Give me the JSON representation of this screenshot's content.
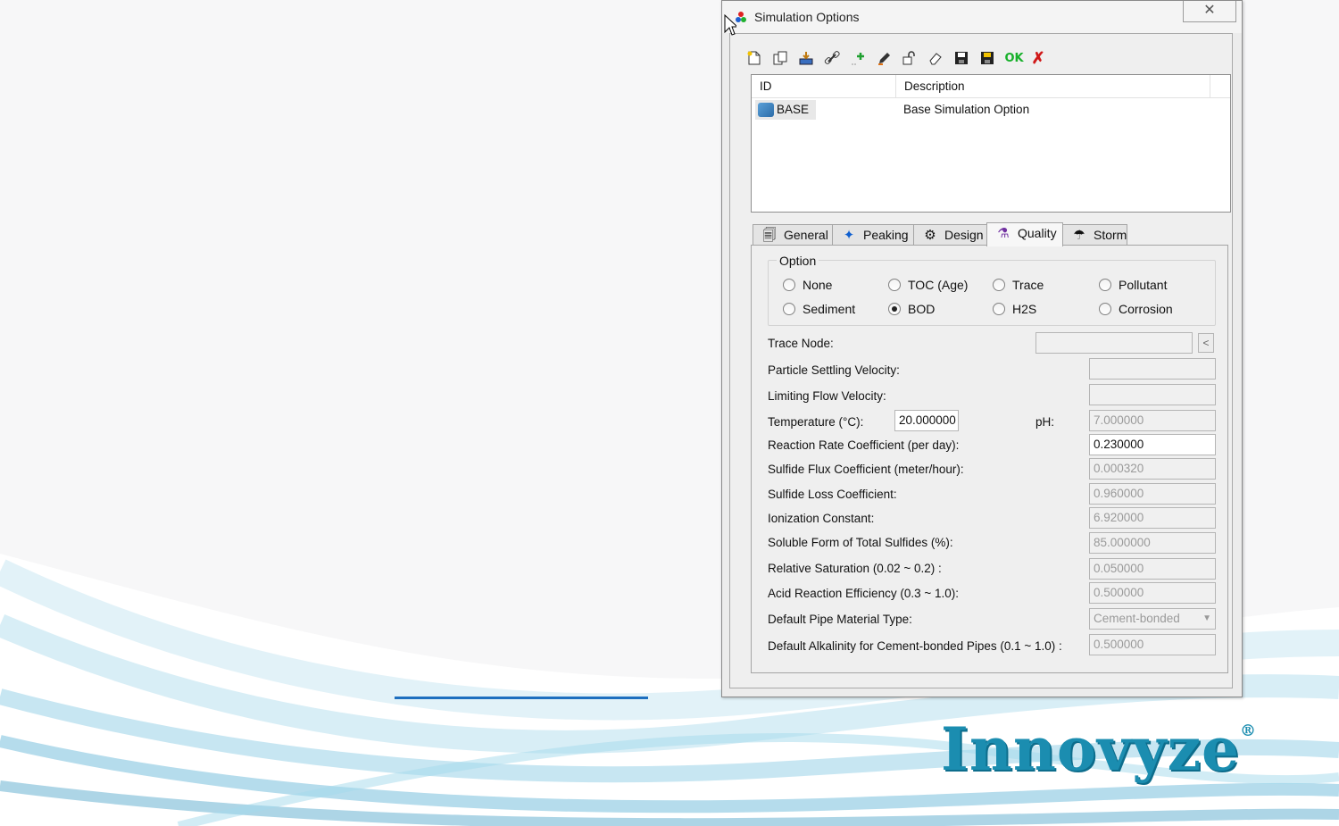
{
  "window": {
    "title": "Simulation Options",
    "close_label": "✕"
  },
  "toolbar": {
    "buttons": [
      {
        "icon": "new-icon"
      },
      {
        "icon": "copy-icon"
      },
      {
        "icon": "import-icon"
      },
      {
        "icon": "link-icon"
      },
      {
        "icon": "add-icon"
      },
      {
        "icon": "edit-icon"
      },
      {
        "icon": "unlock-icon"
      },
      {
        "icon": "eraser-icon"
      },
      {
        "icon": "save-icon"
      },
      {
        "icon": "save-all-icon"
      }
    ],
    "ok_label": "OK",
    "cancel_label": "✗"
  },
  "list": {
    "columns": [
      "ID",
      "Description"
    ],
    "rows": [
      {
        "id": "BASE",
        "description": "Base Simulation Option"
      }
    ]
  },
  "tabs": [
    {
      "label": "General",
      "icon": "general-icon"
    },
    {
      "label": "Peaking",
      "icon": "peaking-icon"
    },
    {
      "label": "Design",
      "icon": "design-icon"
    },
    {
      "label": "Quality",
      "icon": "quality-icon",
      "active": true
    },
    {
      "label": "Storm",
      "icon": "storm-icon"
    }
  ],
  "option_group": {
    "label": "Option",
    "options": [
      "None",
      "TOC (Age)",
      "Trace",
      "Pollutant",
      "Sediment",
      "BOD",
      "H2S",
      "Corrosion"
    ],
    "selected": "BOD"
  },
  "fields": {
    "trace_node": {
      "label": "Trace Node:",
      "value": ""
    },
    "particle_settling_velocity": {
      "label": "Particle Settling Velocity:",
      "value": ""
    },
    "limiting_flow_velocity": {
      "label": "Limiting Flow Velocity:",
      "value": ""
    },
    "temperature": {
      "label": "Temperature (°C):",
      "value": "20.000000"
    },
    "ph": {
      "label": "pH:",
      "value": "7.000000"
    },
    "reaction_rate_coefficient": {
      "label": "Reaction Rate Coefficient (per day):",
      "value": "0.230000"
    },
    "sulfide_flux_coefficient": {
      "label": "Sulfide Flux Coefficient (meter/hour):",
      "value": "0.000320"
    },
    "sulfide_loss_coefficient": {
      "label": "Sulfide Loss Coefficient:",
      "value": "0.960000"
    },
    "ionization_constant": {
      "label": "Ionization Constant:",
      "value": "6.920000"
    },
    "soluble_form_total_sulfides": {
      "label": "Soluble Form of Total Sulfides (%):",
      "value": "85.000000"
    },
    "relative_saturation": {
      "label": "Relative Saturation (0.02 ~ 0.2) :",
      "value": "0.050000"
    },
    "acid_reaction_efficiency": {
      "label": "Acid Reaction Efficiency (0.3 ~ 1.0):",
      "value": "0.500000"
    },
    "default_pipe_material": {
      "label": "Default Pipe Material Type:",
      "value": "Cement-bonded"
    },
    "default_alkalinity": {
      "label": "Default Alkalinity for Cement-bonded Pipes (0.1 ~ 1.0) :",
      "value": "0.500000"
    }
  },
  "brand": {
    "logo_text": "Innovyze",
    "registered": "®",
    "color": "#1b8db0"
  }
}
